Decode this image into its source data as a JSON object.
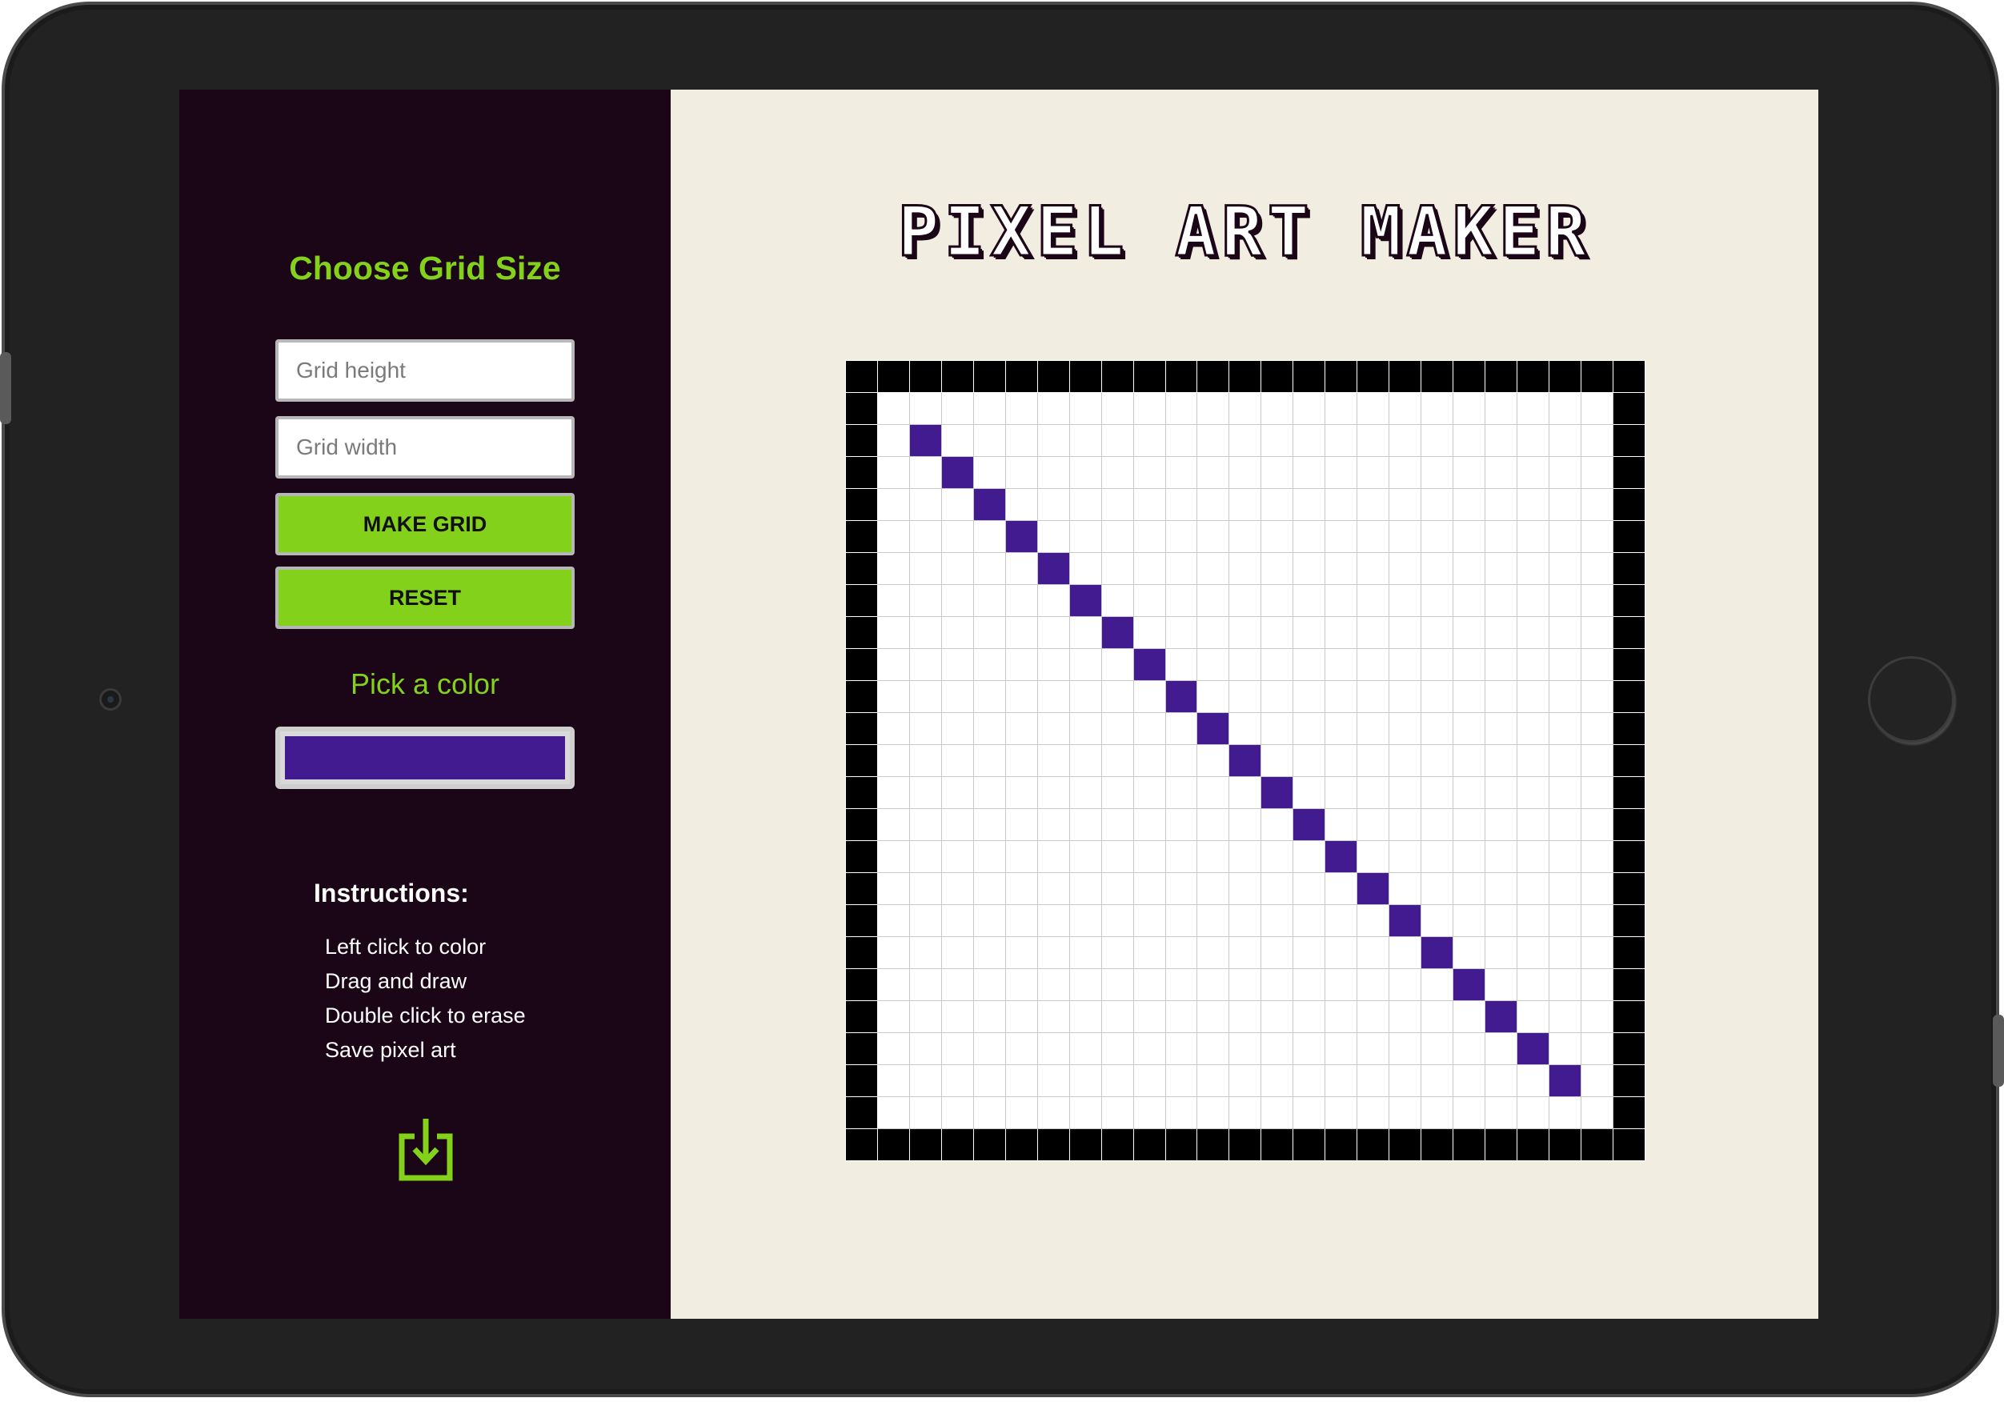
{
  "sidebar": {
    "heading": "Choose Grid Size",
    "height_placeholder": "Grid height",
    "width_placeholder": "Grid width",
    "make_grid_label": "MAKE GRID",
    "reset_label": "RESET",
    "pick_color_label": "Pick a color",
    "selected_color": "#421b91",
    "instructions_title": "Instructions:",
    "instructions": [
      "Left click to color",
      "Drag and draw",
      "Double click to erase",
      "Save pixel art"
    ],
    "save_icon": "download-icon"
  },
  "main": {
    "title": "PIXEL ART MAKER"
  },
  "grid": {
    "rows": 25,
    "cols": 25,
    "border_color": "#000000",
    "paint_color": "#421b91",
    "painted_cells": [
      [
        2,
        2
      ],
      [
        3,
        3
      ],
      [
        4,
        4
      ],
      [
        5,
        5
      ],
      [
        6,
        6
      ],
      [
        7,
        7
      ],
      [
        8,
        8
      ],
      [
        9,
        9
      ],
      [
        10,
        10
      ],
      [
        11,
        11
      ],
      [
        12,
        12
      ],
      [
        13,
        13
      ],
      [
        14,
        14
      ],
      [
        15,
        15
      ],
      [
        16,
        16
      ],
      [
        17,
        17
      ],
      [
        18,
        18
      ],
      [
        19,
        19
      ],
      [
        20,
        20
      ],
      [
        21,
        21
      ],
      [
        22,
        22
      ]
    ]
  },
  "colors": {
    "accent": "#84d11c",
    "sidebar_bg": "#1b0617",
    "main_bg": "#f1ede1"
  }
}
